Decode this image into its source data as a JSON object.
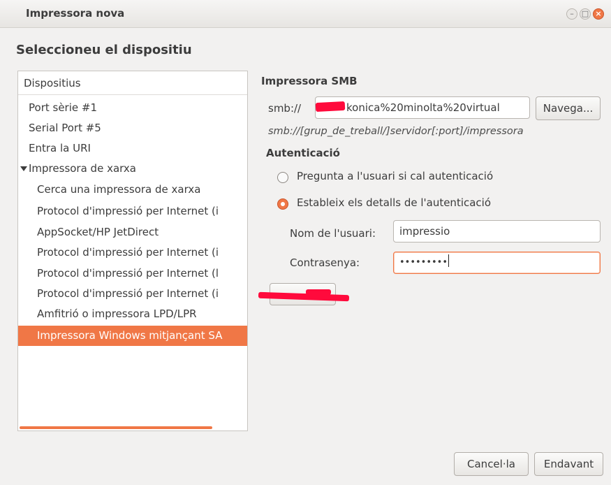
{
  "window": {
    "title": "Impressora nova",
    "controls": {
      "minimize": "–",
      "maximize": "□",
      "close": "×"
    }
  },
  "page_title": "Seleccioneu el dispositiu",
  "devices": {
    "header": "Dispositius",
    "items": [
      {
        "label": "Port sèrie #1"
      },
      {
        "label": "Serial Port #5"
      },
      {
        "label": "Entra la URI"
      },
      {
        "label": "Impressora de xarxa"
      },
      {
        "label": "Cerca una impressora de xarxa"
      },
      {
        "label": "Protocol d'impressió per Internet (i"
      },
      {
        "label": "AppSocket/HP JetDirect"
      },
      {
        "label": "Protocol d'impressió per Internet (i"
      },
      {
        "label": "Protocol d'impressió per Internet (l"
      },
      {
        "label": "Protocol d'impressió per Internet (i"
      },
      {
        "label": "Amfitrió o impressora LPD/LPR"
      },
      {
        "label": "Impressora Windows mitjançant SA"
      }
    ]
  },
  "smb": {
    "section_title": "Impressora SMB",
    "prefix": "smb://",
    "uri_value": "konica%20minolta%20virtual",
    "browse_label": "Navega...",
    "hint": "smb://[grup_de_treball/]servidor[:port]/impressora"
  },
  "auth": {
    "section_title": "Autenticació",
    "option_prompt": "Pregunta a l'usuari si cal autenticació",
    "option_set": "Estableix els detalls de l'autenticació",
    "username_label": "Nom de l'usuari:",
    "username_value": "impressio",
    "password_label": "Contrasenya:",
    "password_value": "•••••••••"
  },
  "footer": {
    "cancel_label": "Cancel·la",
    "forward_label": "Endavant"
  },
  "colors": {
    "accent": "#f07746",
    "redaction": "#ff0a3c"
  }
}
